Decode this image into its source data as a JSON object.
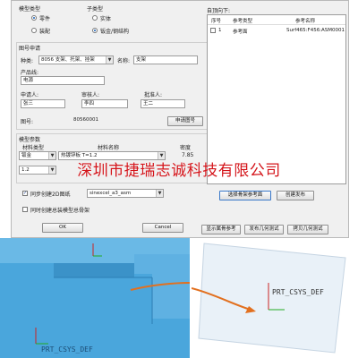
{
  "dialog": {
    "model_type": {
      "title": "模型类型",
      "part": "零件",
      "assembly": "装配"
    },
    "sub_type": {
      "title": "子类型",
      "solid": "实体",
      "sheetmetal": "钣金/钢结构"
    },
    "drawing_req": {
      "title": "图号申请",
      "kind_label": "种类:",
      "kind_value": "8056 支架、托架、挂架",
      "name_label": "名称:",
      "name_value": "支架"
    },
    "category": {
      "label": "产品线:",
      "value": "电源"
    },
    "people": {
      "applicant_label": "申请人:",
      "applicant": "张三",
      "reviewer_label": "审核人:",
      "reviewer": "李四",
      "approver_label": "批准人:",
      "approver": "王二"
    },
    "drawing_no": {
      "label": "图号:",
      "value": "80560001",
      "button": "申请图号"
    },
    "model_params": {
      "title": "模型参数",
      "col_material_type": "材料类型",
      "col_material_name": "材料名称",
      "col_density": "密度",
      "material_type": "钣金",
      "material_name": "热镀锌板 T=1.2",
      "density": "7.85",
      "extra_value": "1.2"
    },
    "create_2d": {
      "label": "同步创建2D图纸",
      "template": "sinexcel_a3_asm",
      "checked": "✓"
    },
    "create_asm": {
      "label": "同时创建总装模型总骨架"
    },
    "ok_button": "OK",
    "cancel_button": "Cancel",
    "top_down": {
      "title": "自顶向下:",
      "col_no": "序号",
      "col_ref_type": "参考类型",
      "col_ref_name": "参考名称",
      "row_no": "1",
      "row_type": "参考面",
      "row_name": "Surf465:F456:ASM0001"
    },
    "select_ref_button": "选择骨架参考面",
    "create_publish_button": "创建发布",
    "show_ref_button": "显示属骨参考",
    "publish_geom_button": "发布几何测试",
    "copy_geom_button": "拷贝几何测试"
  },
  "watermark": "深圳市捷瑞志诚科技有限公司",
  "views": {
    "left_csys": "PRT_CSYS_DEF",
    "right_csys": "PRT_CSYS_DEF"
  },
  "colors": {
    "dialog_bg": "#f0f0f0",
    "model_blue": "#4aa6dc",
    "arrow_orange": "#e2701f",
    "watermark_red": "#d4141a"
  }
}
